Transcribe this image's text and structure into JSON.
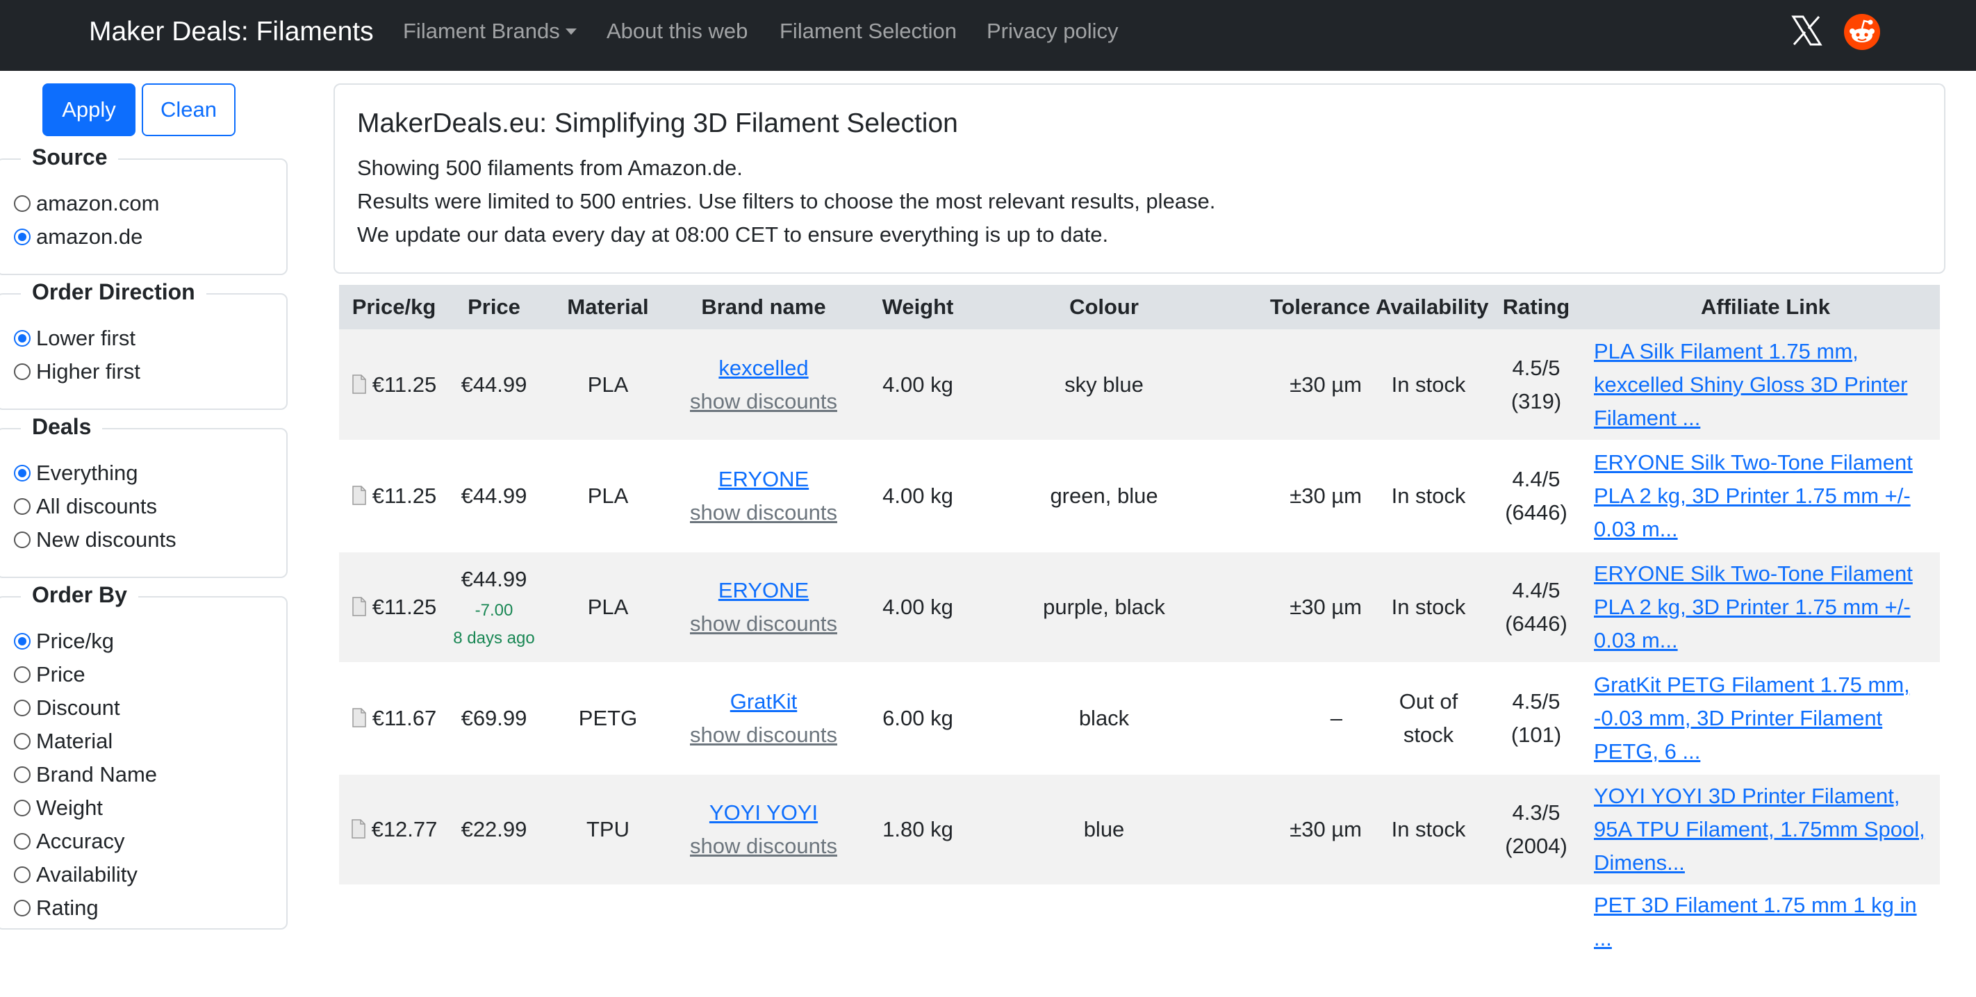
{
  "navbar": {
    "brand": "Maker Deals: Filaments",
    "links": [
      "Filament Brands",
      "About this web",
      "Filament Selection",
      "Privacy policy"
    ],
    "icons": [
      "x-twitter-icon",
      "reddit-icon"
    ],
    "colors": {
      "background": "#212529",
      "reddit": "#ff4500"
    }
  },
  "sidebar": {
    "apply_label": "Apply",
    "clean_label": "Clean",
    "source": {
      "legend": "Source",
      "options": [
        "amazon.com",
        "amazon.de"
      ],
      "selected": "amazon.de"
    },
    "order_direction": {
      "legend": "Order Direction",
      "options": [
        "Lower first",
        "Higher first"
      ],
      "selected": "Lower first"
    },
    "deals": {
      "legend": "Deals",
      "options": [
        "Everything",
        "All discounts",
        "New discounts"
      ],
      "selected": "Everything"
    },
    "order_by": {
      "legend": "Order By",
      "options": [
        "Price/kg",
        "Price",
        "Discount",
        "Material",
        "Brand Name",
        "Weight",
        "Accuracy",
        "Availability",
        "Rating"
      ],
      "selected": "Price/kg"
    }
  },
  "info": {
    "title": "MakerDeals.eu: Simplifying 3D Filament Selection",
    "line1": "Showing 500 filaments from Amazon.de.",
    "line2": "Results were limited to 500 entries. Use filters to choose the most relevant results, please.",
    "line3": "We update our data every day at 08:00 CET to ensure everything is up to date."
  },
  "table": {
    "headers": [
      "Price/kg",
      "Price",
      "Material",
      "Brand name",
      "Weight",
      "Colour",
      "Tolerance",
      "Availability",
      "Rating",
      "Affiliate Link"
    ],
    "show_discounts": "show discounts",
    "rows": [
      {
        "price_kg": "€11.25",
        "price": "€44.99",
        "change": "",
        "change_age": "",
        "material": "PLA",
        "brand": "kexcelled",
        "weight": "4.00 kg",
        "colour": "sky blue",
        "tolerance": "±30 µm",
        "availability": "In stock",
        "rating": "4.5/5",
        "reviews": "(319)",
        "link": "PLA Silk Filament 1.75 mm, kexcelled Shiny Gloss 3D Printer Filament ..."
      },
      {
        "price_kg": "€11.25",
        "price": "€44.99",
        "change": "",
        "change_age": "",
        "material": "PLA",
        "brand": "ERYONE",
        "weight": "4.00 kg",
        "colour": "green, blue",
        "tolerance": "±30 µm",
        "availability": "In stock",
        "rating": "4.4/5",
        "reviews": "(6446)",
        "link": "ERYONE Silk Two-Tone Filament PLA 2 kg, 3D Printer 1.75 mm +/- 0.03 m..."
      },
      {
        "price_kg": "€11.25",
        "price": "€44.99",
        "change": "-7.00",
        "change_age": "8 days ago",
        "material": "PLA",
        "brand": "ERYONE",
        "weight": "4.00 kg",
        "colour": "purple, black",
        "tolerance": "±30 µm",
        "availability": "In stock",
        "rating": "4.4/5",
        "reviews": "(6446)",
        "link": "ERYONE Silk Two-Tone Filament PLA 2 kg, 3D Printer 1.75 mm +/- 0.03 m..."
      },
      {
        "price_kg": "€11.67",
        "price": "€69.99",
        "change": "",
        "change_age": "",
        "material": "PETG",
        "brand": "GratKit",
        "weight": "6.00 kg",
        "colour": "black",
        "tolerance": "–",
        "availability": "Out of stock",
        "rating": "4.5/5",
        "reviews": "(101)",
        "link": "GratKit PETG Filament 1.75 mm, -0.03 mm, 3D Printer Filament PETG, 6 ..."
      },
      {
        "price_kg": "€12.77",
        "price": "€22.99",
        "change": "",
        "change_age": "",
        "material": "TPU",
        "brand": "YOYI YOYI",
        "weight": "1.80 kg",
        "colour": "blue",
        "tolerance": "±30 µm",
        "availability": "In stock",
        "rating": "4.3/5",
        "reviews": "(2004)",
        "link": "YOYI YOYI 3D Printer Filament, 95A TPU Filament, 1.75mm Spool, Dimens..."
      },
      {
        "price_kg": "",
        "price": "",
        "change": "",
        "change_age": "",
        "material": "",
        "brand": "",
        "weight": "",
        "colour": "",
        "tolerance": "",
        "availability": "",
        "rating": "",
        "reviews": "",
        "link": "PET 3D Filament 1.75 mm 1 kg in ..."
      }
    ]
  }
}
